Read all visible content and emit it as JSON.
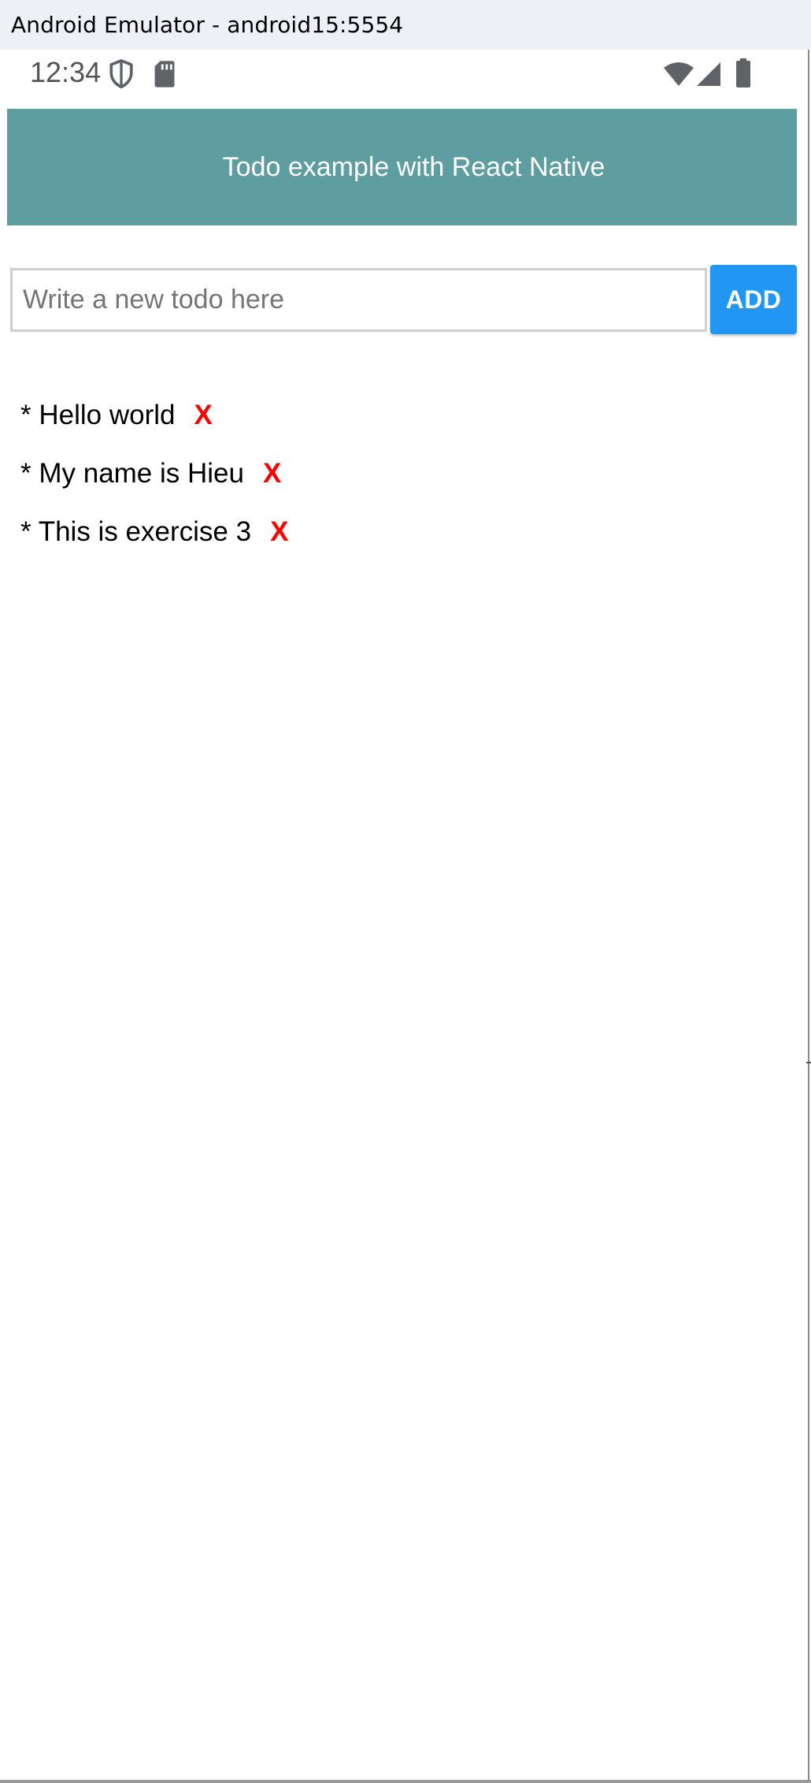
{
  "window": {
    "title": "Android Emulator - android15:5554"
  },
  "status_bar": {
    "time": "12:34",
    "icons": [
      "shield-icon",
      "sd-card-icon",
      "wifi-icon",
      "cell-signal-icon",
      "battery-icon"
    ],
    "icon_color": "#5f6368"
  },
  "app": {
    "header_title": "Todo example with React Native",
    "header_color": "#5f9ea0",
    "input": {
      "placeholder": "Write a new todo here",
      "value": ""
    },
    "add_button_label": "ADD",
    "add_button_color": "#2196f3",
    "todos": [
      {
        "text": "* Hello world",
        "delete_label": "X"
      },
      {
        "text": "* My name is Hieu",
        "delete_label": "X"
      },
      {
        "text": "* This is exercise 3",
        "delete_label": "X"
      }
    ],
    "delete_color": "#ff0000"
  }
}
